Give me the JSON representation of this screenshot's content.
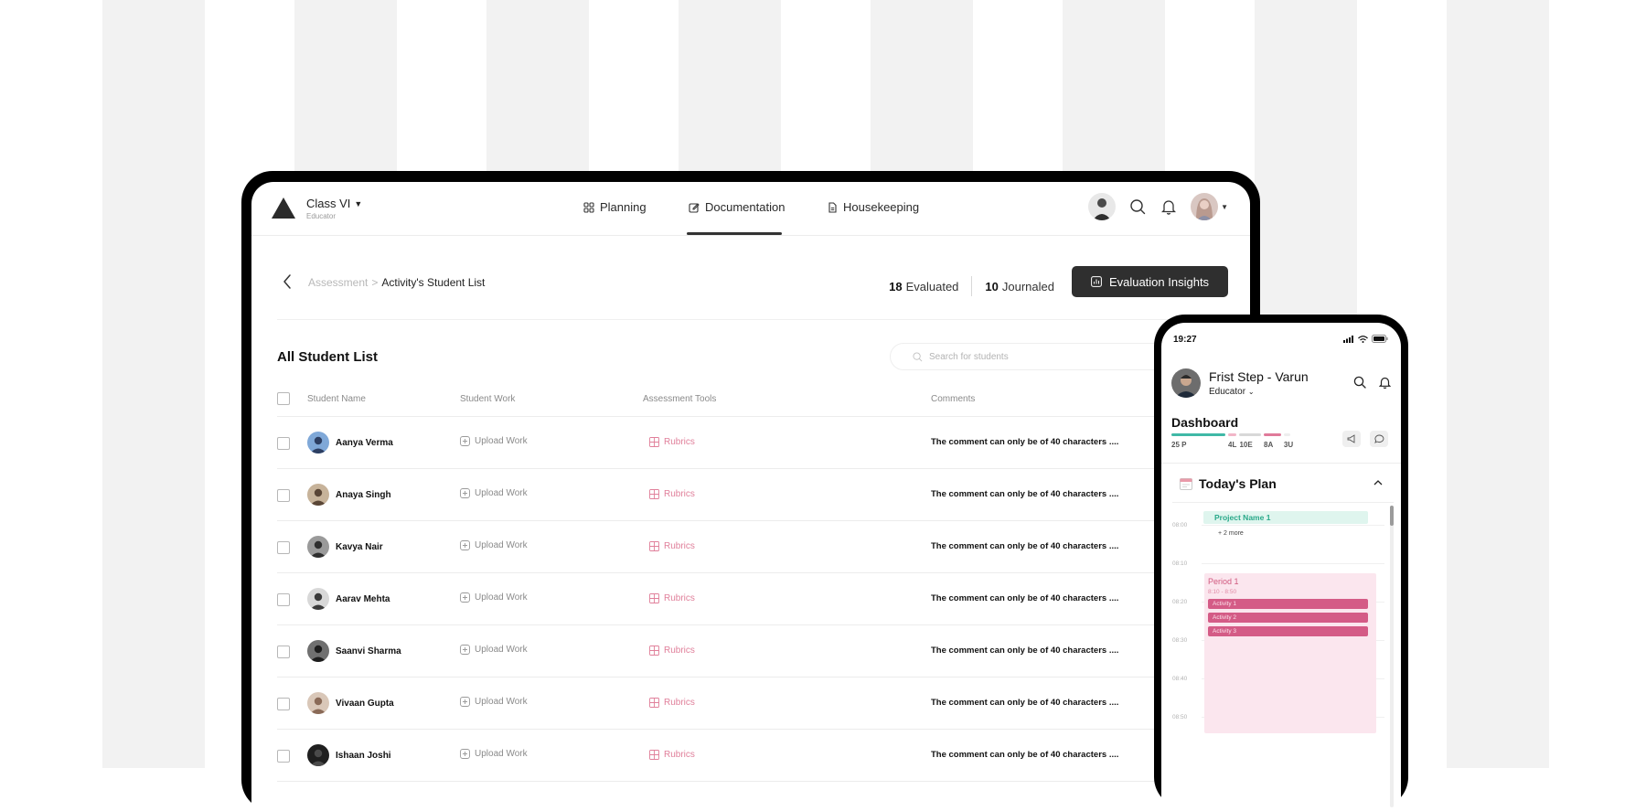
{
  "nav": {
    "class_name": "Class VI",
    "class_role": "Educator",
    "tabs": [
      {
        "label": "Planning",
        "icon": "grid-icon"
      },
      {
        "label": "Documentation",
        "icon": "edit-icon"
      },
      {
        "label": "Housekeeping",
        "icon": "document-icon"
      }
    ],
    "active_tab": "Documentation"
  },
  "breadcrumb": {
    "parent": "Assessment",
    "separator": ">",
    "current": "Activity's Student List"
  },
  "stats": {
    "evaluated_count": "18",
    "evaluated_label": "Evaluated",
    "journaled_count": "10",
    "journaled_label": "Journaled"
  },
  "insights_button": "Evaluation Insights",
  "list": {
    "title": "All Student List",
    "search_placeholder": "Search for students",
    "columns": [
      "Student Name",
      "Student Work",
      "Assessment Tools",
      "Comments"
    ],
    "rows": [
      {
        "name": "Aanya Verma",
        "work": "Upload Work",
        "tool": "Rubrics",
        "comment": "The comment can only be of 40 characters ...."
      },
      {
        "name": "Anaya Singh",
        "work": "Upload Work",
        "tool": "Rubrics",
        "comment": "The comment can only be of 40 characters ...."
      },
      {
        "name": "Kavya Nair",
        "work": "Upload Work",
        "tool": "Rubrics",
        "comment": "The comment can only be of 40 characters ...."
      },
      {
        "name": "Aarav Mehta",
        "work": "Upload Work",
        "tool": "Rubrics",
        "comment": "The comment can only be of 40 characters ...."
      },
      {
        "name": "Saanvi Sharma",
        "work": "Upload Work",
        "tool": "Rubrics",
        "comment": "The comment can only be of 40 characters ...."
      },
      {
        "name": "Vivaan Gupta",
        "work": "Upload Work",
        "tool": "Rubrics",
        "comment": "The comment can only be of 40 characters ...."
      },
      {
        "name": "Ishaan Joshi",
        "work": "Upload Work",
        "tool": "Rubrics",
        "comment": "The comment can only be of 40 characters ...."
      }
    ]
  },
  "phone": {
    "time": "19:27",
    "user_name": "Frist Step - Varun",
    "user_role": "Educator",
    "dashboard_title": "Dashboard",
    "attendance": [
      {
        "label": "25 P",
        "value": 25,
        "color": "#3fb8a6"
      },
      {
        "label": "4L",
        "value": 4,
        "color": "#f2b6c8"
      },
      {
        "label": "10E",
        "value": 10,
        "color": "#d8d8d8"
      },
      {
        "label": "8A",
        "value": 8,
        "color": "#e07a9a"
      },
      {
        "label": "3U",
        "value": 3,
        "color": "#eeeeee"
      }
    ],
    "plan_title": "Today's Plan",
    "project": "Project Name 1",
    "more": "+ 2 more",
    "times": [
      "08:00",
      "08:10",
      "08:20",
      "08:30",
      "08:40",
      "08:50"
    ],
    "period": {
      "name": "Period 1",
      "time": "8:10 - 8:50",
      "activities": [
        "Activity 1",
        "Activity 2",
        "Activity 3"
      ]
    }
  },
  "colors": {
    "accent_dark": "#2f2f2f",
    "rubric_pink": "#e07f9a",
    "period_bg": "#fbe6ee",
    "activity": "#d45b86",
    "project_bg": "#dff5ee"
  }
}
